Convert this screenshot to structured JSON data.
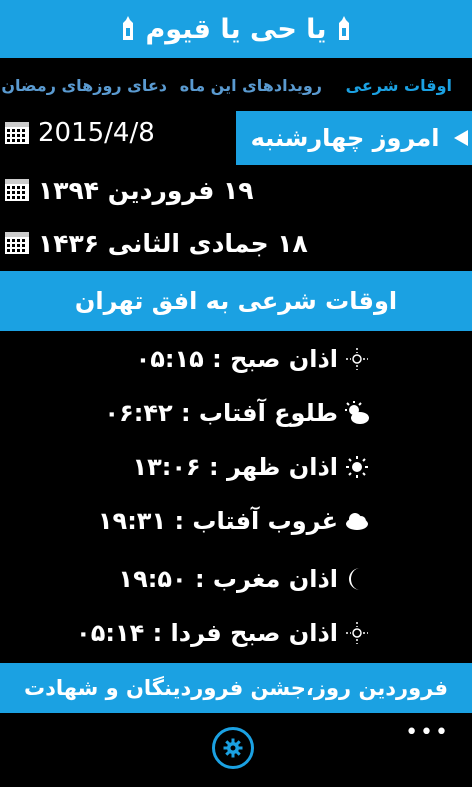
{
  "header": {
    "title": "یا حی یا قیوم"
  },
  "tabs": [
    {
      "label": "اوقات شرعی",
      "active": true
    },
    {
      "label": "رویدادهای این ماه",
      "active": false
    },
    {
      "label": "دعای روزهای رمضان",
      "active": false
    }
  ],
  "dates": {
    "gregorian": "2015/4/8",
    "solar": "۱۹ فروردین ۱۳۹۴",
    "lunar": "۱۸ جمادی الثانی ۱۴۳۶"
  },
  "today": {
    "label": "امروز چهارشنبه"
  },
  "prayer_section": {
    "title": "اوقات شرعی به افق تهران",
    "times": [
      {
        "label": "اذان صبح : ۰۵:۱۵",
        "icon": "dawn-icon"
      },
      {
        "label": "طلوع آفتاب : ۰۶:۴۲",
        "icon": "sunrise-icon"
      },
      {
        "label": "اذان ظهر : ۱۳:۰۶",
        "icon": "sun-icon"
      },
      {
        "label": "غروب آفتاب : ۱۹:۳۱",
        "icon": "cloud-icon"
      },
      {
        "label": "اذان مغرب : ۱۹:۵۰",
        "icon": "moon-icon"
      },
      {
        "label": "اذان صبح فردا : ۰۵:۱۴",
        "icon": "dawn-icon"
      }
    ]
  },
  "event": {
    "text": "فروردین روز،جشن فروردینگان و شهادت"
  },
  "appbar": {
    "more_label": "•••"
  },
  "colors": {
    "accent": "#1ba1e2",
    "background": "#000000"
  }
}
